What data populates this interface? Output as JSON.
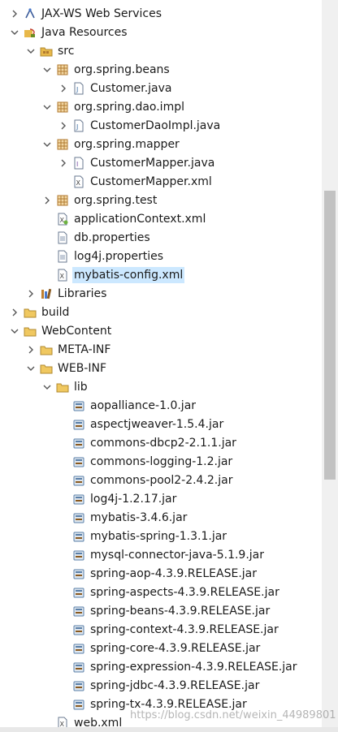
{
  "tree": [
    {
      "label": "JAX-WS Web Services",
      "icon": "web-services-icon",
      "arrow": "right",
      "depth": 1
    },
    {
      "label": "Java Resources",
      "icon": "java-resources-icon",
      "arrow": "down",
      "depth": 1
    },
    {
      "label": "src",
      "icon": "source-folder-icon",
      "arrow": "down",
      "depth": 2
    },
    {
      "label": "org.spring.beans",
      "icon": "package-icon",
      "arrow": "down",
      "depth": 3
    },
    {
      "label": "Customer.java",
      "icon": "java-file-icon",
      "arrow": "right",
      "depth": 4
    },
    {
      "label": "org.spring.dao.impl",
      "icon": "package-icon",
      "arrow": "down",
      "depth": 3
    },
    {
      "label": "CustomerDaoImpl.java",
      "icon": "java-file-icon",
      "arrow": "right",
      "depth": 4
    },
    {
      "label": "org.spring.mapper",
      "icon": "package-icon",
      "arrow": "down",
      "depth": 3
    },
    {
      "label": "CustomerMapper.java",
      "icon": "java-interface-file-icon",
      "arrow": "right",
      "depth": 4
    },
    {
      "label": "CustomerMapper.xml",
      "icon": "xml-file-icon",
      "arrow": "none",
      "depth": 4
    },
    {
      "label": "org.spring.test",
      "icon": "package-icon",
      "arrow": "right",
      "depth": 3
    },
    {
      "label": "applicationContext.xml",
      "icon": "spring-xml-file-icon",
      "arrow": "none",
      "depth": 3
    },
    {
      "label": "db.properties",
      "icon": "properties-file-icon",
      "arrow": "none",
      "depth": 3
    },
    {
      "label": "log4j.properties",
      "icon": "properties-file-icon",
      "arrow": "none",
      "depth": 3
    },
    {
      "label": "mybatis-config.xml",
      "icon": "xml-file-icon",
      "arrow": "none",
      "depth": 3,
      "selected": true
    },
    {
      "label": "Libraries",
      "icon": "libraries-icon",
      "arrow": "right",
      "depth": 2
    },
    {
      "label": "build",
      "icon": "folder-icon",
      "arrow": "right",
      "depth": 1
    },
    {
      "label": "WebContent",
      "icon": "folder-icon",
      "arrow": "down",
      "depth": 1
    },
    {
      "label": "META-INF",
      "icon": "folder-icon",
      "arrow": "right",
      "depth": 2
    },
    {
      "label": "WEB-INF",
      "icon": "folder-icon",
      "arrow": "down",
      "depth": 2
    },
    {
      "label": "lib",
      "icon": "folder-icon",
      "arrow": "down",
      "depth": 3
    },
    {
      "label": "aopalliance-1.0.jar",
      "icon": "jar-icon",
      "arrow": "none",
      "depth": 4
    },
    {
      "label": "aspectjweaver-1.5.4.jar",
      "icon": "jar-icon",
      "arrow": "none",
      "depth": 4
    },
    {
      "label": "commons-dbcp2-2.1.1.jar",
      "icon": "jar-icon",
      "arrow": "none",
      "depth": 4
    },
    {
      "label": "commons-logging-1.2.jar",
      "icon": "jar-icon",
      "arrow": "none",
      "depth": 4
    },
    {
      "label": "commons-pool2-2.4.2.jar",
      "icon": "jar-icon",
      "arrow": "none",
      "depth": 4
    },
    {
      "label": "log4j-1.2.17.jar",
      "icon": "jar-icon",
      "arrow": "none",
      "depth": 4
    },
    {
      "label": "mybatis-3.4.6.jar",
      "icon": "jar-icon",
      "arrow": "none",
      "depth": 4
    },
    {
      "label": "mybatis-spring-1.3.1.jar",
      "icon": "jar-icon",
      "arrow": "none",
      "depth": 4
    },
    {
      "label": "mysql-connector-java-5.1.9.jar",
      "icon": "jar-icon",
      "arrow": "none",
      "depth": 4
    },
    {
      "label": "spring-aop-4.3.9.RELEASE.jar",
      "icon": "jar-icon",
      "arrow": "none",
      "depth": 4
    },
    {
      "label": "spring-aspects-4.3.9.RELEASE.jar",
      "icon": "jar-icon",
      "arrow": "none",
      "depth": 4
    },
    {
      "label": "spring-beans-4.3.9.RELEASE.jar",
      "icon": "jar-icon",
      "arrow": "none",
      "depth": 4
    },
    {
      "label": "spring-context-4.3.9.RELEASE.jar",
      "icon": "jar-icon",
      "arrow": "none",
      "depth": 4
    },
    {
      "label": "spring-core-4.3.9.RELEASE.jar",
      "icon": "jar-icon",
      "arrow": "none",
      "depth": 4
    },
    {
      "label": "spring-expression-4.3.9.RELEASE.jar",
      "icon": "jar-icon",
      "arrow": "none",
      "depth": 4
    },
    {
      "label": "spring-jdbc-4.3.9.RELEASE.jar",
      "icon": "jar-icon",
      "arrow": "none",
      "depth": 4
    },
    {
      "label": "spring-tx-4.3.9.RELEASE.jar",
      "icon": "jar-icon",
      "arrow": "none",
      "depth": 4
    },
    {
      "label": "web.xml",
      "icon": "xml-file-icon",
      "arrow": "none",
      "depth": 3
    }
  ],
  "watermark": "https://blog.csdn.net/weixin_44989801",
  "scroll": {
    "thumb_start": 0.26,
    "thumb_end": 0.655
  },
  "colors": {
    "selection": "#cce8ff",
    "folder": "#e8b84a",
    "package": "#b07a30",
    "jar": "#5a7fa8"
  }
}
